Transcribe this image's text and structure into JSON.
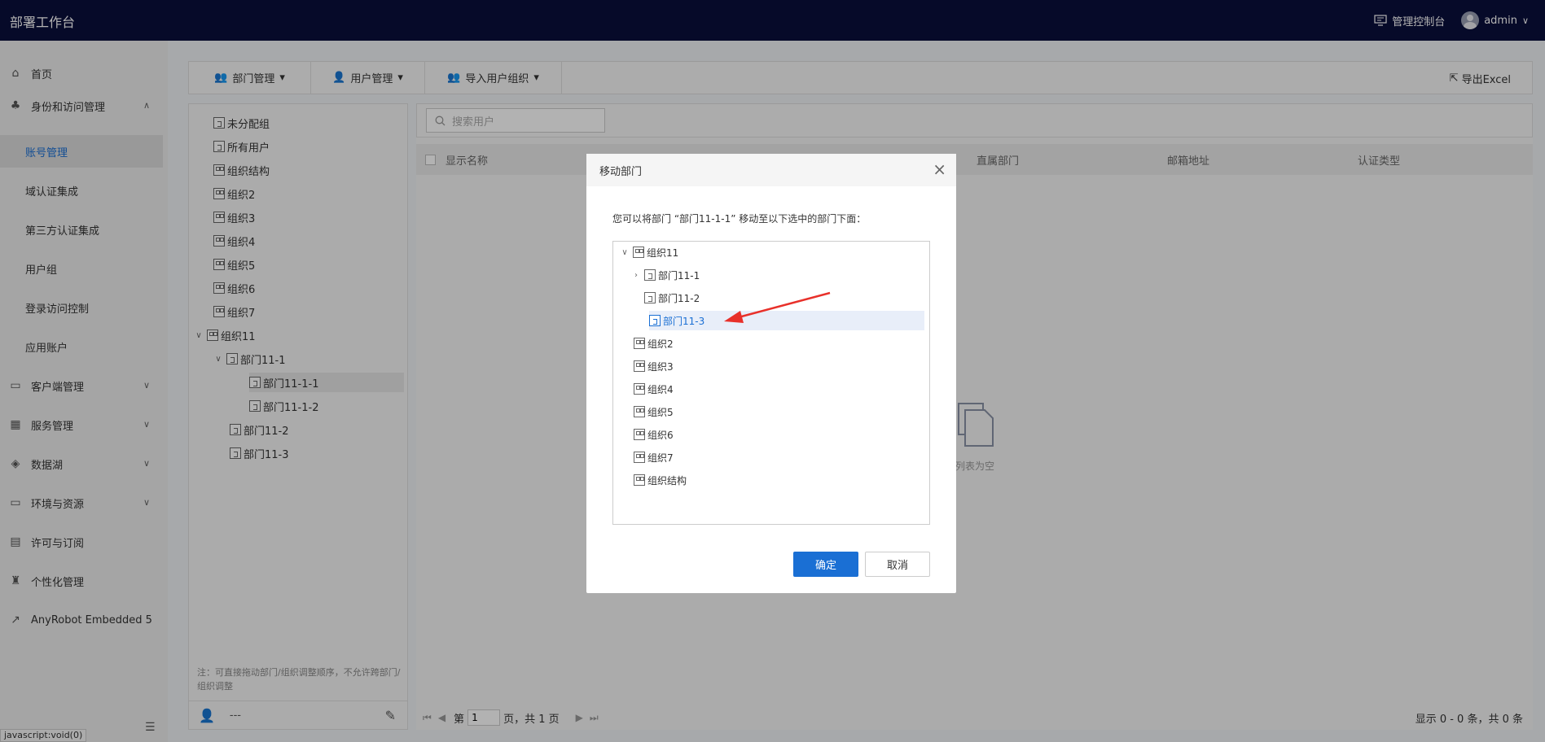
{
  "topbar": {
    "title": "部署工作台",
    "console": "管理控制台",
    "user": "admin"
  },
  "sidebar": {
    "home": "首页",
    "iam": "身份和访问管理",
    "iam_sub": [
      "账号管理",
      "域认证集成",
      "第三方认证集成",
      "用户组",
      "登录访问控制",
      "应用账户"
    ],
    "client": "客户端管理",
    "service": "服务管理",
    "datalake": "数据湖",
    "env": "环境与资源",
    "license": "许可与订阅",
    "personal": "个性化管理",
    "anyrobot": "AnyRobot Embedded 5",
    "url_tip": "javascript:void(0)"
  },
  "toolbar": {
    "dept": "部门管理",
    "user": "用户管理",
    "import": "导入用户组织",
    "export": "导出Excel"
  },
  "tree": {
    "items": [
      "未分配组",
      "所有用户",
      "组织结构",
      "组织2",
      "组织3",
      "组织4",
      "组织5",
      "组织6",
      "组织7",
      "组织11",
      "部门11-1",
      "部门11-1-1",
      "部门11-1-2",
      "部门11-2",
      "部门11-3"
    ],
    "note": "注：可直接拖动部门/组织调整顺序，不允许跨部门/组织调整",
    "foot": "---"
  },
  "main": {
    "search_placeholder": "搜索用户",
    "columns": [
      "显示名称",
      "直属部门",
      "邮箱地址",
      "认证类型"
    ],
    "empty": "列表为空",
    "pager": {
      "prefix": "第",
      "page": "1",
      "suffix": "页，共 1 页",
      "summary": "显示 0 - 0 条，共 0 条"
    }
  },
  "dialog": {
    "title": "移动部门",
    "desc": "您可以将部门 “部门11-1-1” 移动至以下选中的部门下面：",
    "tree": [
      "组织11",
      "部门11-1",
      "部门11-2",
      "部门11-3",
      "组织2",
      "组织3",
      "组织4",
      "组织5",
      "组织6",
      "组织7",
      "组织结构"
    ],
    "ok": "确定",
    "cancel": "取消"
  }
}
